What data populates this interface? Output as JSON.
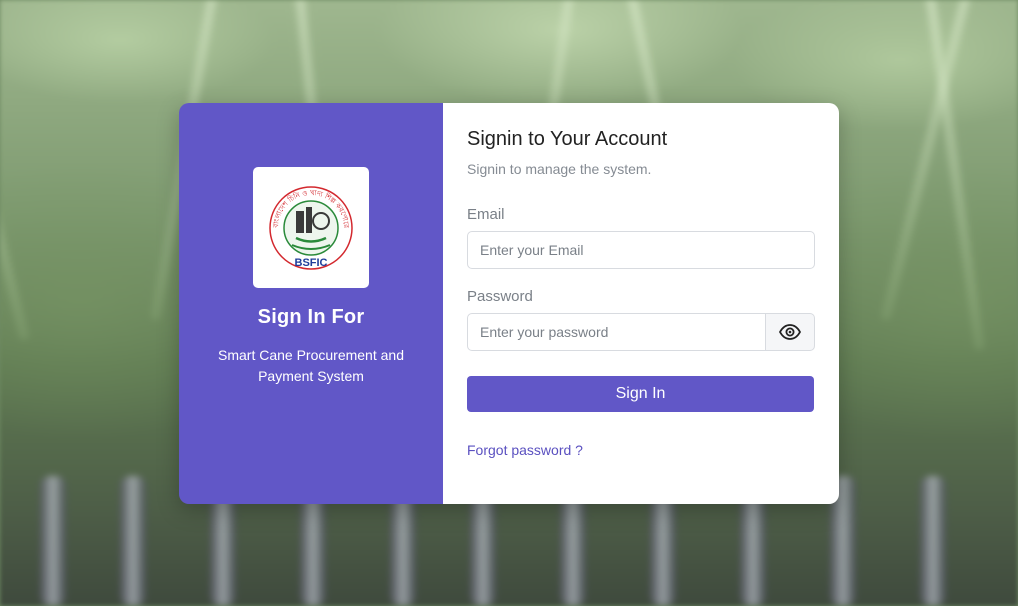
{
  "background": {
    "description": "blurred sugarcane field"
  },
  "brand_panel": {
    "logo_text": "BSFIC",
    "logo_arc_text": "বাংলাদেশ চিনি ও খাদ্য শিল্প করপোরেশন",
    "title": "Sign In For",
    "subtitle": "Smart Cane Procurement and Payment System",
    "color": "#6157c7"
  },
  "form": {
    "title": "Signin to Your Account",
    "subtitle": "Signin to manage the system.",
    "email": {
      "label": "Email",
      "placeholder": "Enter your Email",
      "value": ""
    },
    "password": {
      "label": "Password",
      "placeholder": "Enter your password",
      "value": "",
      "toggle_icon": "eye-icon"
    },
    "submit_label": "Sign In",
    "forgot_label": "Forgot password ?"
  },
  "colors": {
    "accent": "#6157c7",
    "link": "#5a50c0"
  }
}
